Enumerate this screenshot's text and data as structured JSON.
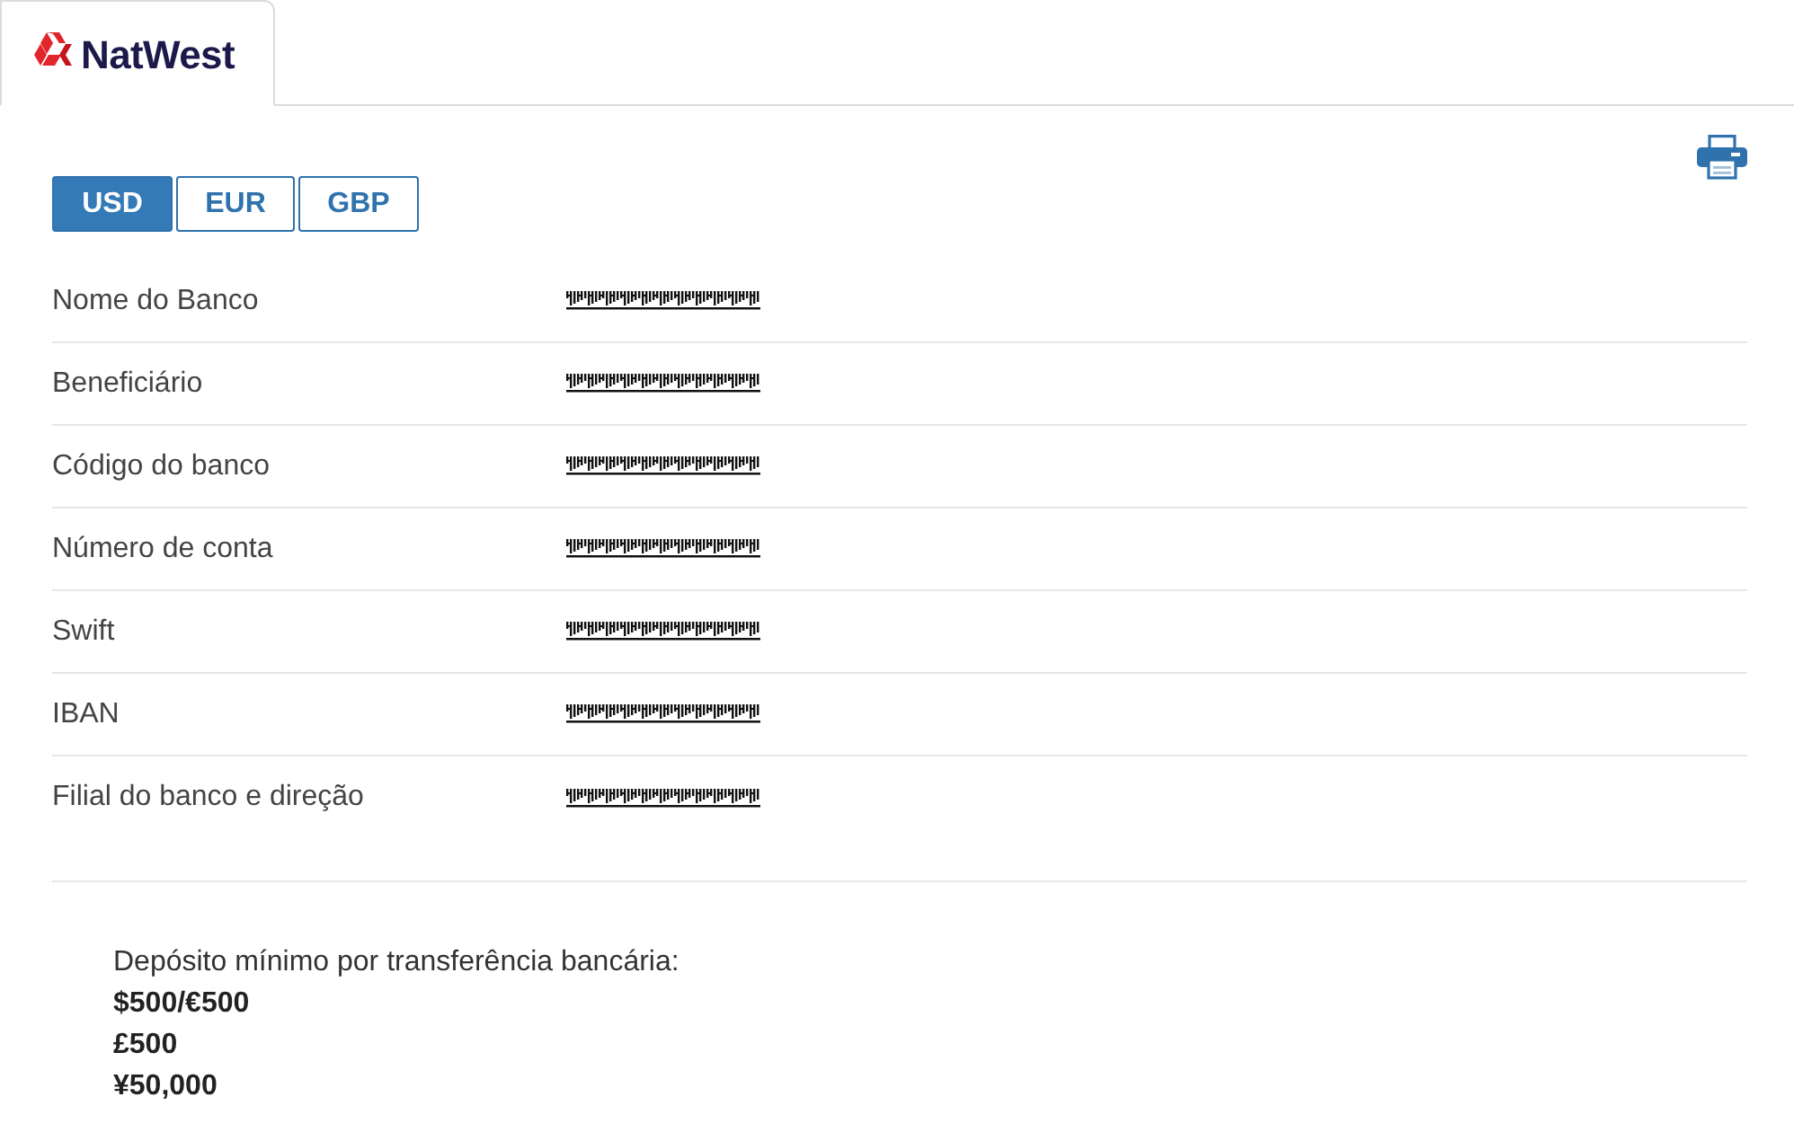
{
  "bank_tabs": [
    {
      "label": "NatWest",
      "selected": true
    }
  ],
  "currencies": [
    {
      "label": "USD",
      "selected": true
    },
    {
      "label": "EUR",
      "selected": false
    },
    {
      "label": "GBP",
      "selected": false
    }
  ],
  "details": [
    {
      "label": "Nome do Banco"
    },
    {
      "label": "Beneficiário"
    },
    {
      "label": "Código do banco"
    },
    {
      "label": "Número de conta"
    },
    {
      "label": "Swift"
    },
    {
      "label": "IBAN"
    },
    {
      "label": "Filial do banco e direção"
    }
  ],
  "minimum_deposit": {
    "title": "Depósito mínimo por transferência bancária:",
    "amounts": [
      "$500/€500",
      "£500",
      "¥50,000"
    ]
  }
}
